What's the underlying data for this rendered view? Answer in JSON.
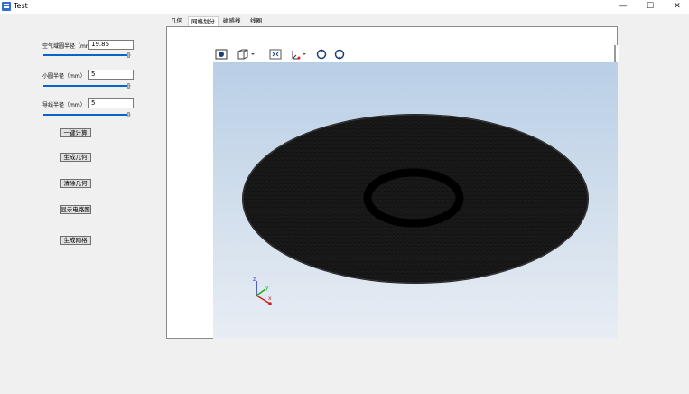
{
  "window": {
    "title": "Test",
    "controls": {
      "minimize": "—",
      "maximize": "☐",
      "close": "✕"
    }
  },
  "params": [
    {
      "label": "空气域圆半径（mm）",
      "value": "19.85",
      "slider_fraction": 0.97
    },
    {
      "label": "小圆半径（mm）",
      "value": "5",
      "slider_fraction": 0.97
    },
    {
      "label": "导线半径（mm）",
      "value": "5",
      "slider_fraction": 0.97
    }
  ],
  "actions": {
    "one_click": "一键计算",
    "generate_geometry": "生成几何",
    "clear_geometry": "清除几何",
    "show_circuit": "显示电路图",
    "generate_mesh": "生成网格"
  },
  "tabs": [
    "几何",
    "网格划分",
    "磁感线",
    "线圈"
  ],
  "active_tab": "网格划分",
  "toolbar": {
    "icons": [
      "camera-icon",
      "cube-view-icon",
      "fit-view-icon",
      "axis-orient-icon",
      "rotate-left-icon",
      "rotate-right-icon"
    ]
  },
  "axes": {
    "z": "z",
    "y": "y",
    "x": "x"
  },
  "colors": {
    "accent": "#0a64c8",
    "mesh": "#151515",
    "viewport_top": "#b9cfe6",
    "viewport_bottom": "#e8edf3"
  }
}
